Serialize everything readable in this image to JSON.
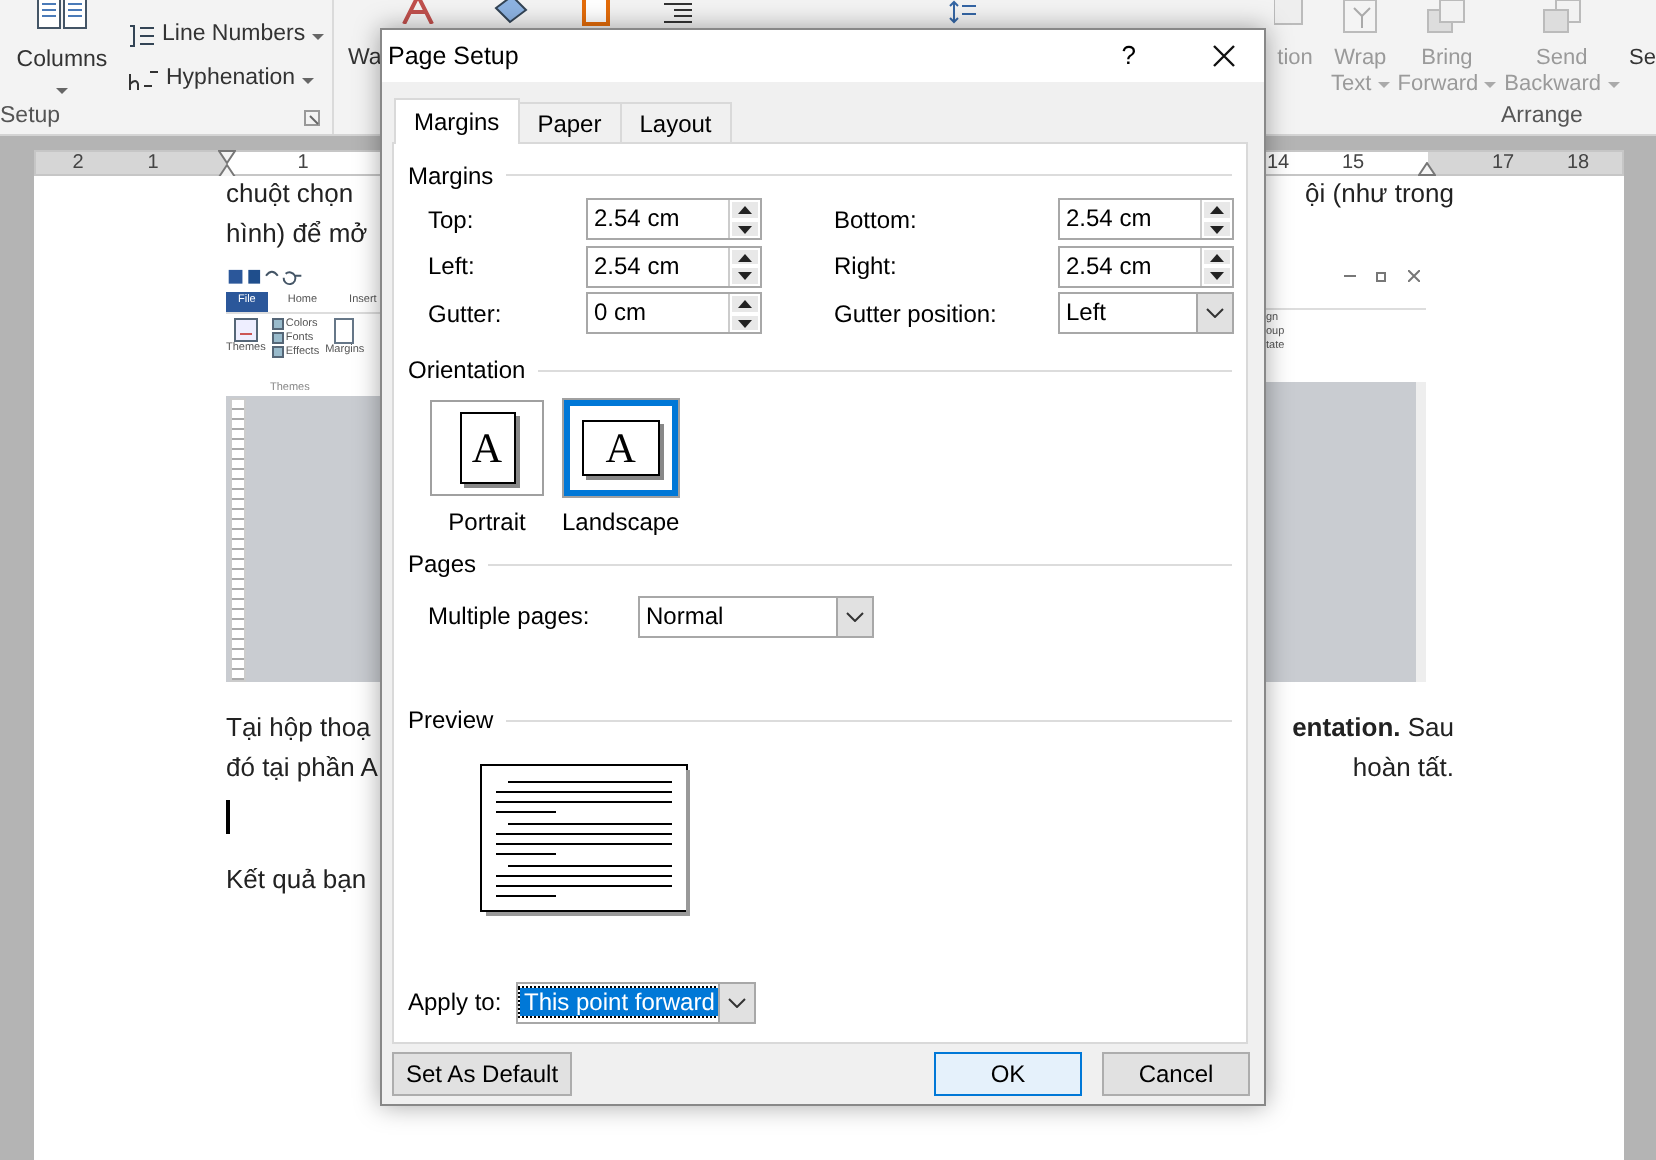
{
  "ribbon": {
    "columns": {
      "label": "Columns",
      "caret": true
    },
    "small_buttons": [
      {
        "label": "Line Numbers",
        "caret": true
      },
      {
        "label": "Hyphenation",
        "caret": true
      }
    ],
    "setup_group": "Setup",
    "watermark_cut": "Wa",
    "arrange_buttons": [
      {
        "lines": [
          "tion"
        ],
        "caret": false,
        "disabled": true
      },
      {
        "lines": [
          "Wrap",
          "Text"
        ],
        "caret": true,
        "disabled": true
      },
      {
        "lines": [
          "Bring",
          "Forward"
        ],
        "caret": true,
        "disabled": true
      },
      {
        "lines": [
          "Send",
          "Backward"
        ],
        "caret": true,
        "disabled": true
      },
      {
        "lines": [
          "Se"
        ],
        "caret": false,
        "disabled": false
      }
    ],
    "arrange_group": "Arrange"
  },
  "ruler": {
    "left_margin_labels": [
      "2",
      "1"
    ],
    "body_start_labels": [
      "1"
    ],
    "body_end_labels": [
      "14",
      "15"
    ],
    "right_margin_labels": [
      "17",
      "18"
    ]
  },
  "document": {
    "top_lines": [
      {
        "left": "chuột chọn",
        "right": "ội (như trong"
      },
      {
        "left": "hình) để mở"
      }
    ],
    "embedded_screenshot": {
      "tabs": [
        {
          "label": "File",
          "selected": true
        },
        {
          "label": "Home",
          "selected": false
        },
        {
          "label": "Insert",
          "selected": false
        }
      ],
      "themes_button": "Themes",
      "theme_items": [
        "Colors",
        "Fonts",
        "Effects"
      ],
      "margins_button": "Margins",
      "group_label": "Themes",
      "right_items": [
        "gn",
        "oup",
        "tate"
      ]
    },
    "bottom_lines": [
      {
        "left": "Tại hộp thoạ",
        "right": "**entation.** Sau"
      },
      {
        "left": "đó tại phần A",
        "right": "hoàn tất."
      }
    ],
    "last_line": "Kết quả bạn"
  },
  "dialog": {
    "title": "Page Setup",
    "help": "?",
    "tabs": [
      {
        "label": "Margins",
        "selected": true
      },
      {
        "label": "Paper",
        "selected": false
      },
      {
        "label": "Layout",
        "selected": false
      }
    ],
    "margins_heading": "Margins",
    "margin_fields": [
      {
        "kind": "spin",
        "label": "Top:",
        "value": "2.54 cm"
      },
      {
        "kind": "spin",
        "label": "Bottom:",
        "value": "2.54 cm"
      },
      {
        "kind": "spin",
        "label": "Left:",
        "value": "2.54 cm"
      },
      {
        "kind": "spin",
        "label": "Right:",
        "value": "2.54 cm"
      },
      {
        "kind": "spin",
        "label": "Gutter:",
        "value": "0 cm"
      },
      {
        "kind": "select",
        "label": "Gutter position:",
        "value": "Left"
      }
    ],
    "orientation_heading": "Orientation",
    "orientations": [
      {
        "label": "Portrait",
        "glyph": "A",
        "kind": "portrait",
        "selected": false
      },
      {
        "label": "Landscape",
        "glyph": "A",
        "kind": "landscape",
        "selected": true
      }
    ],
    "pages_heading": "Pages",
    "multiple_pages": {
      "label": "Multiple pages:",
      "value": "Normal"
    },
    "preview_heading": "Preview",
    "apply_to": {
      "label": "Apply to:",
      "value": "This point forward",
      "highlighted": true
    },
    "buttons": [
      {
        "label": "Set As Default",
        "default": false
      },
      {
        "label": "OK",
        "default": true
      },
      {
        "label": "Cancel",
        "default": false
      }
    ]
  }
}
